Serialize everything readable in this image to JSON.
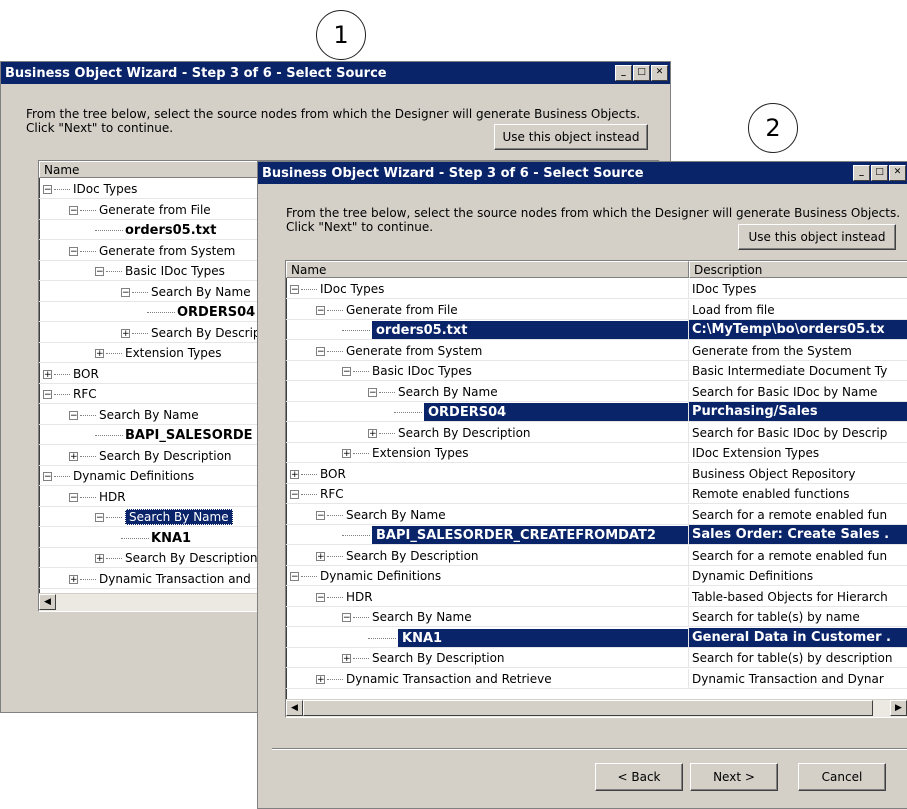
{
  "callouts": [
    "1",
    "2"
  ],
  "intro_line1": "From the tree below, select the source nodes from which the Designer will generate Business Objects.",
  "intro_line1_front": "From the tree below, select the source nodes from which the Designer will generate Business Objects.",
  "intro_line2": "Click \"Next\" to continue.",
  "window_title": "Business Object Wizard - Step 3 of 6 - Select Source",
  "use_object_button": "Use this object instead",
  "columns": {
    "name": "Name",
    "description": "Description"
  },
  "buttons": {
    "back": "< Back",
    "next": "Next >",
    "cancel": "Cancel"
  },
  "back_tree": [
    {
      "label": "IDoc Types"
    },
    {
      "label": "Generate from File"
    },
    {
      "label": "orders05.txt"
    },
    {
      "label": "Generate from System"
    },
    {
      "label": "Basic IDoc Types"
    },
    {
      "label": "Search By Name"
    },
    {
      "label": "ORDERS04"
    },
    {
      "label": "Search By Descrip"
    },
    {
      "label": "Extension Types"
    },
    {
      "label": "BOR"
    },
    {
      "label": "RFC"
    },
    {
      "label": "Search By Name"
    },
    {
      "label": "BAPI_SALESORDE"
    },
    {
      "label": "Search By Description"
    },
    {
      "label": "Dynamic Definitions"
    },
    {
      "label": "HDR"
    },
    {
      "label": "Search By Name"
    },
    {
      "label": "KNA1"
    },
    {
      "label": "Search By Description"
    },
    {
      "label": "Dynamic Transaction and"
    }
  ],
  "front_tree": [
    {
      "label": "IDoc Types",
      "desc": "IDoc Types"
    },
    {
      "label": "Generate from File",
      "desc": "Load from file"
    },
    {
      "label": "orders05.txt",
      "desc": "C:\\MyTemp\\bo\\orders05.tx"
    },
    {
      "label": "Generate from System",
      "desc": "Generate from the System"
    },
    {
      "label": "Basic IDoc Types",
      "desc": "Basic Intermediate Document Ty"
    },
    {
      "label": "Search By Name",
      "desc": "Search for Basic IDoc by Name"
    },
    {
      "label": "ORDERS04",
      "desc": "Purchasing/Sales"
    },
    {
      "label": "Search By Description",
      "desc": "Search for Basic IDoc by Descrip"
    },
    {
      "label": "Extension Types",
      "desc": "IDoc Extension Types"
    },
    {
      "label": "BOR",
      "desc": "Business Object Repository"
    },
    {
      "label": "RFC",
      "desc": "Remote enabled functions"
    },
    {
      "label": "Search By Name",
      "desc": "Search for a remote enabled fun"
    },
    {
      "label": "BAPI_SALESORDER_CREATEFROMDAT2",
      "desc": "Sales Order: Create Sales ."
    },
    {
      "label": "Search By Description",
      "desc": "Search for a remote enabled fun"
    },
    {
      "label": "Dynamic Definitions",
      "desc": "Dynamic Definitions"
    },
    {
      "label": "HDR",
      "desc": "Table-based Objects for Hierarch"
    },
    {
      "label": "Search By Name",
      "desc": "Search for table(s) by name"
    },
    {
      "label": "KNA1",
      "desc": "General Data in Customer ."
    },
    {
      "label": "Search By Description",
      "desc": "Search for table(s) by description"
    },
    {
      "label": "Dynamic Transaction and Retrieve",
      "desc": "Dynamic Transaction and Dynar"
    }
  ]
}
